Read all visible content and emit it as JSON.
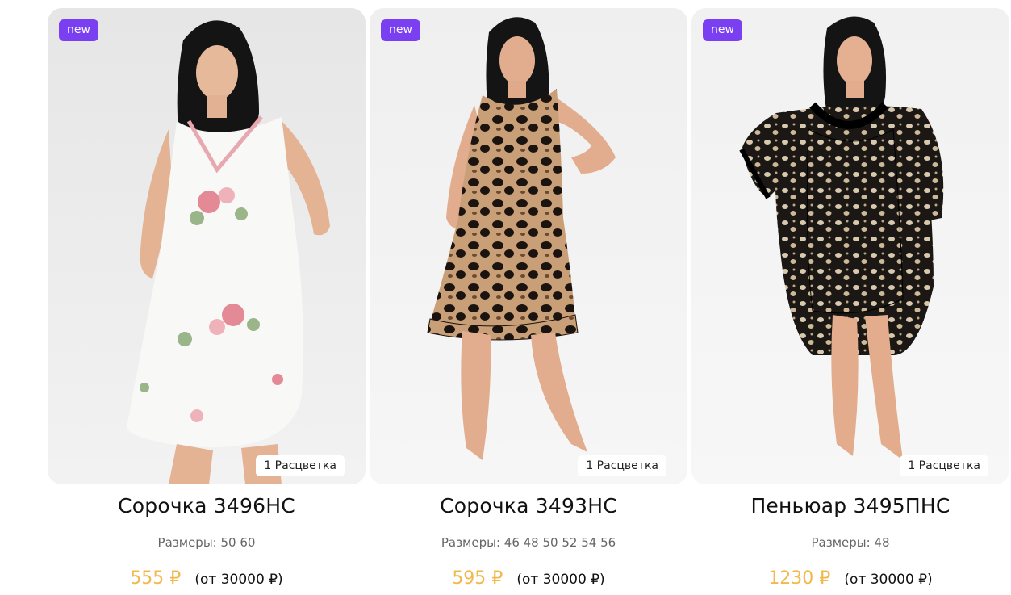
{
  "theme": {
    "badge_color": "#7b3ff2",
    "price_color": "#f2b84b",
    "photo_bg": "#ececec"
  },
  "products": [
    {
      "badge": "new",
      "colors_label": "1 Расцветка",
      "title": "Сорочка 3496НС",
      "sizes": "Размеры: 50 60",
      "price": "555 ₽",
      "min_order": "(от 30000 ₽)",
      "image": "woman-floral-white-nightgown"
    },
    {
      "badge": "new",
      "colors_label": "1 Расцветка",
      "title": "Сорочка 3493НС",
      "sizes": "Размеры: 46 48 50 52 54 56",
      "price": "595 ₽",
      "min_order": "(от 30000 ₽)",
      "image": "woman-leopard-nightgown"
    },
    {
      "badge": "new",
      "colors_label": "1 Расцветка",
      "title": "Пеньюар 3495ПНС",
      "sizes": "Размеры: 48",
      "price": "1230 ₽",
      "min_order": "(от 30000 ₽)",
      "image": "woman-spotted-robe-set"
    }
  ]
}
